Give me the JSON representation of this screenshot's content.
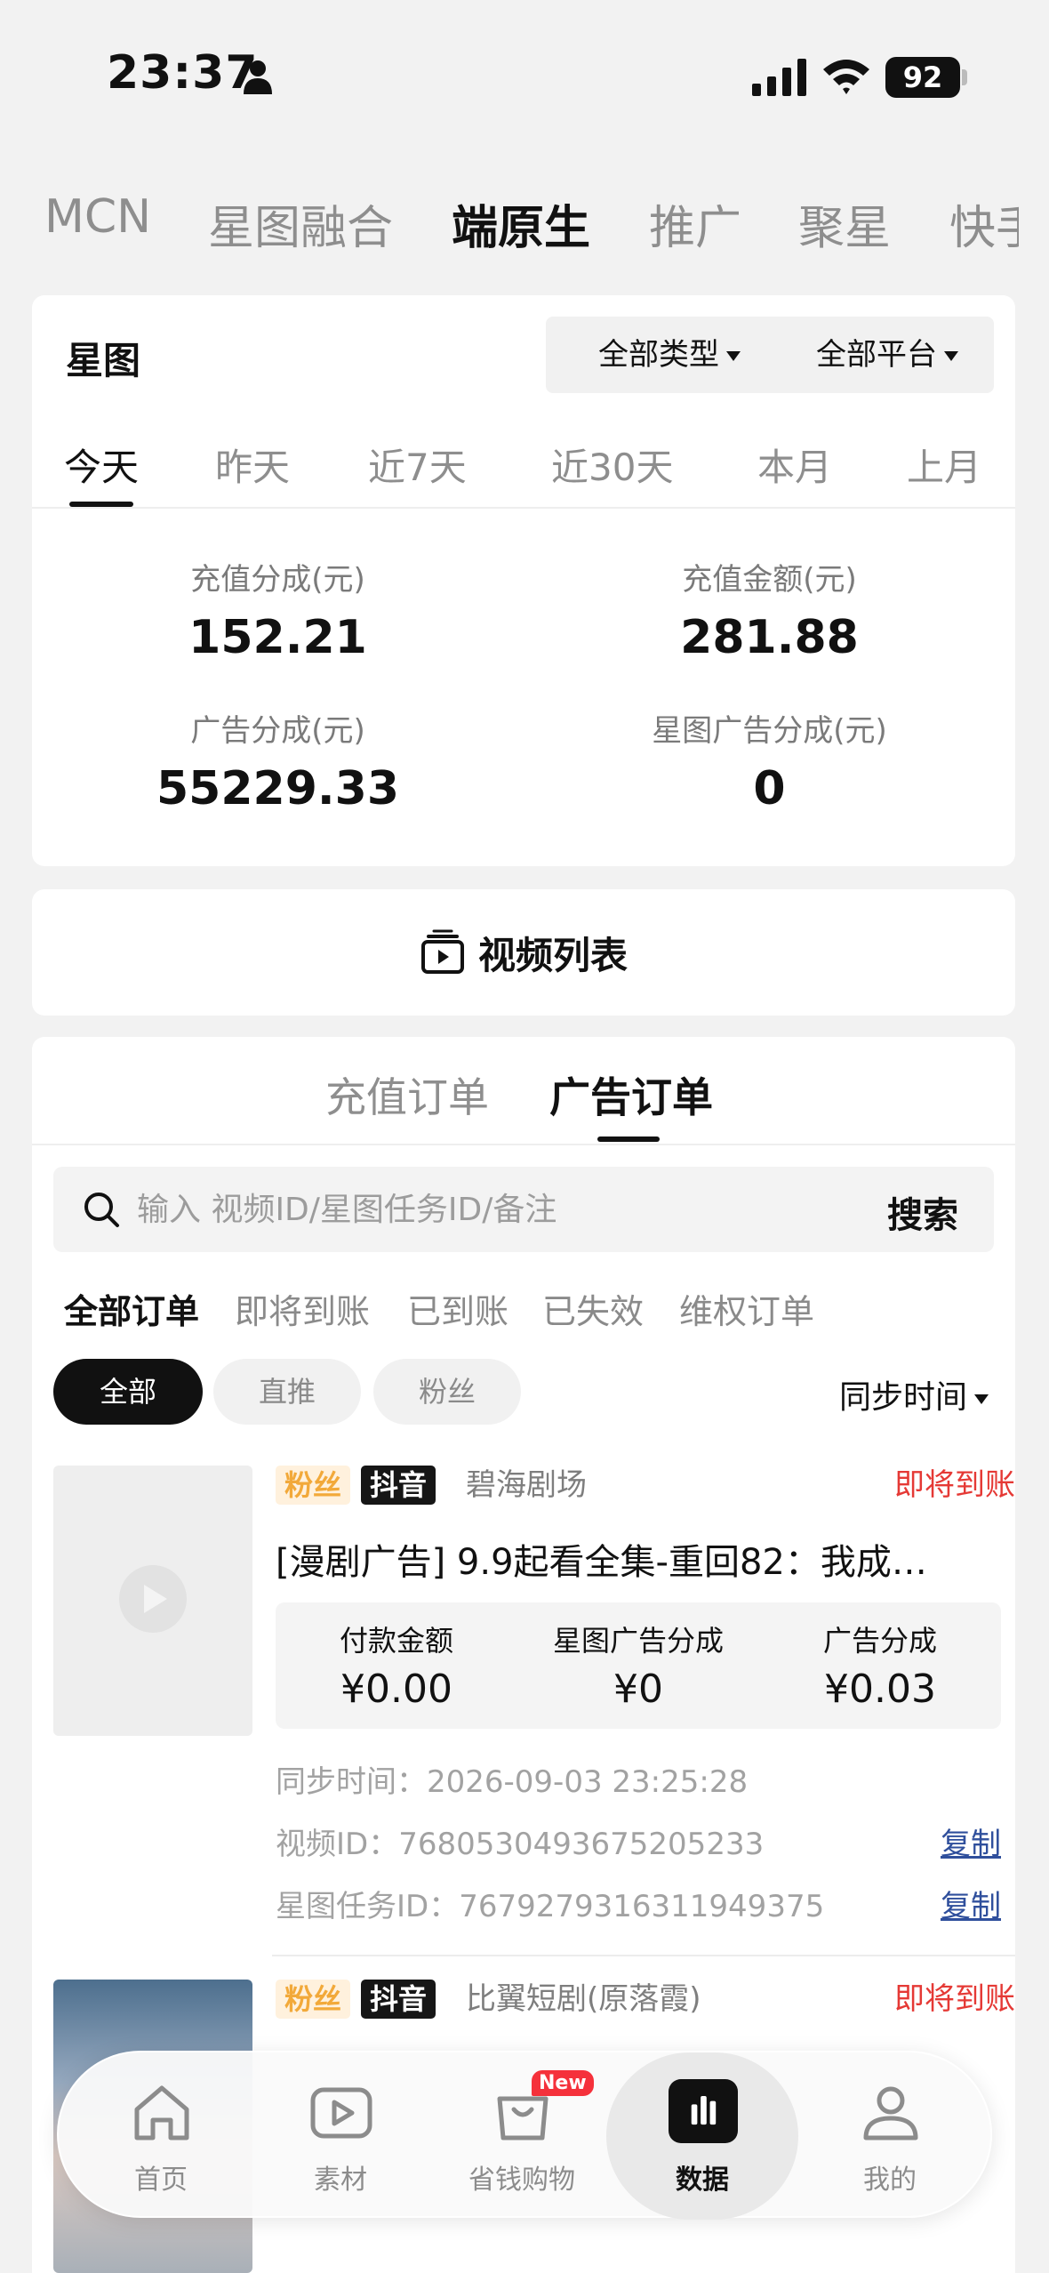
{
  "status_bar": {
    "time": "23:37",
    "battery": "92"
  },
  "top_tabs": [
    "MCN",
    "星图融合",
    "端原生",
    "推广",
    "聚星",
    "快手"
  ],
  "stats": {
    "brand": "星图",
    "type_filter": "全部类型",
    "platform_filter": "全部平台",
    "periods": [
      "今天",
      "昨天",
      "近7天",
      "近30天",
      "本月",
      "上月"
    ],
    "metrics": [
      {
        "label": "充值分成(元)",
        "value": "152.21"
      },
      {
        "label": "充值金额(元)",
        "value": "281.88"
      },
      {
        "label": "广告分成(元)",
        "value": "55229.33"
      },
      {
        "label": "星图广告分成(元)",
        "value": "0"
      }
    ]
  },
  "video_list_label": "视频列表",
  "orders": {
    "tabs": [
      "充值订单",
      "广告订单"
    ],
    "search_placeholder": "输入 视频ID/星图任务ID/备注",
    "search_button": "搜索",
    "status_tabs": [
      "全部订单",
      "即将到账",
      "已到账",
      "已失效",
      "维权订单"
    ],
    "chips": [
      "全部",
      "直推",
      "粉丝"
    ],
    "sort_label": "同步时间",
    "items": [
      {
        "tag_fans": "粉丝",
        "tag_platform": "抖音",
        "source": "碧海剧场",
        "state": "即将到账",
        "title": "[漫剧广告] 9.9起看全集-重回82：我成…",
        "amount_labels": [
          "付款金额",
          "星图广告分成",
          "广告分成"
        ],
        "amount_values": [
          "¥0.00",
          "¥0",
          "¥0.03"
        ],
        "sync_time": "同步时间：2026-09-03 23:25:28",
        "video_id": "视频ID：7680530493675205233",
        "task_id": "星图任务ID：7679279316311949375",
        "copy_label": "复制"
      },
      {
        "tag_fans": "粉丝",
        "tag_platform": "抖音",
        "source": "比翼短剧(原落霞)",
        "state": "即将到账"
      }
    ]
  },
  "bottom_nav": [
    {
      "label": "首页",
      "icon": "home-icon"
    },
    {
      "label": "素材",
      "icon": "play-icon"
    },
    {
      "label": "省钱购物",
      "icon": "shopping-bag-icon",
      "badge": "New"
    },
    {
      "label": "数据",
      "icon": "bar-chart-icon"
    },
    {
      "label": "我的",
      "icon": "user-icon"
    }
  ],
  "colors": {
    "accent_red": "#e53935",
    "link_blue": "#2f4f9c",
    "fans_tag": "#f2a93a"
  }
}
